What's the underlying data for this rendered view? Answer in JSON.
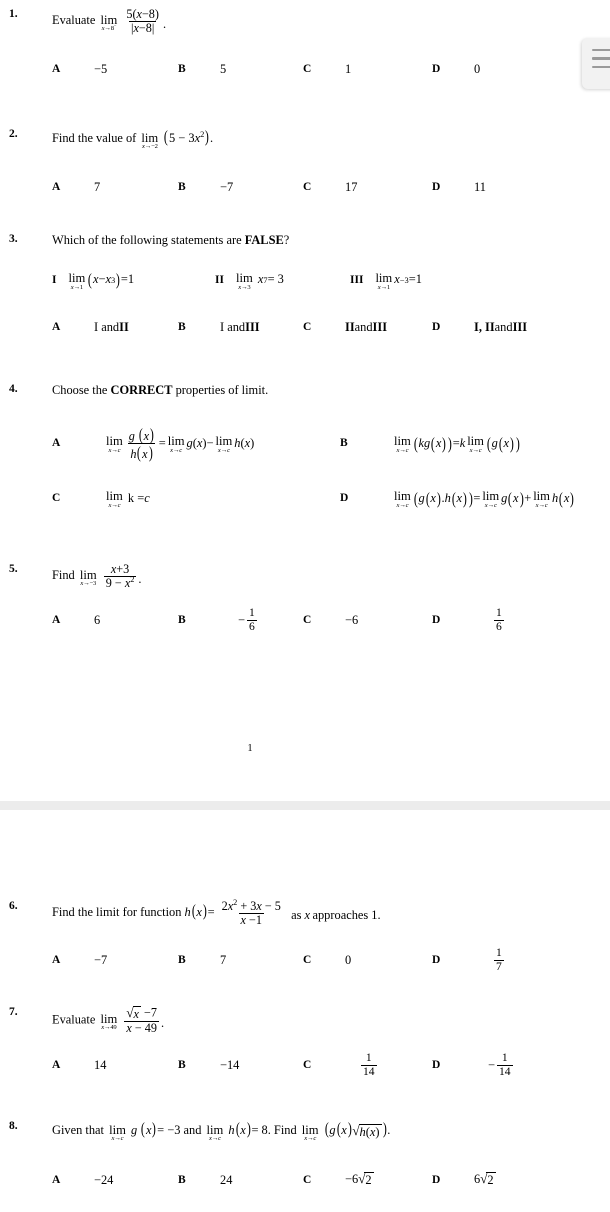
{
  "document": {
    "page_number": "1",
    "floating_widget": {
      "name": "menu-handle",
      "bars": 3
    }
  },
  "questions": [
    {
      "number": "1.",
      "prompt_prefix": "Evaluate",
      "expression": "lim(x→8⁻) 5(x−8)/|x−8|",
      "options": [
        {
          "letter": "A",
          "value": "−5"
        },
        {
          "letter": "B",
          "value": "5"
        },
        {
          "letter": "C",
          "value": "1"
        },
        {
          "letter": "D",
          "value": "0"
        }
      ]
    },
    {
      "number": "2.",
      "prompt_prefix": "Find the value of",
      "expression": "lim(x→−2) (5 − 3x²)",
      "options": [
        {
          "letter": "A",
          "value": "7"
        },
        {
          "letter": "B",
          "value": "−7"
        },
        {
          "letter": "C",
          "value": "17"
        },
        {
          "letter": "D",
          "value": "11"
        }
      ]
    },
    {
      "number": "3.",
      "prompt_prefix": "Which of the following statements are",
      "prompt_bold": "FALSE",
      "prompt_suffix": "?",
      "statements": [
        {
          "label": "I",
          "expression": "lim(x→1)(x − x³) = 1"
        },
        {
          "label": "II",
          "expression": "lim(x→3) x⁷ = 3"
        },
        {
          "label": "III",
          "expression": "lim(x→1) x⁻³ = 1"
        }
      ],
      "options": [
        {
          "letter": "A",
          "value": "I and II"
        },
        {
          "letter": "B",
          "value": "I and III"
        },
        {
          "letter": "C",
          "value": "II and III"
        },
        {
          "letter": "D",
          "value": "I, II and III"
        }
      ]
    },
    {
      "number": "4.",
      "prompt_prefix": "Choose the",
      "prompt_bold": "CORRECT",
      "prompt_suffix": "properties of limit.",
      "options": [
        {
          "letter": "A",
          "value": "lim(x→c) g(x)/h(x) = lim(x→c) g(x) − lim(x→c) h(x)"
        },
        {
          "letter": "B",
          "value": "lim(x→c)(kg(x)) = k lim(x→c)(g(x))"
        },
        {
          "letter": "C",
          "value": "lim(x→c) k = c"
        },
        {
          "letter": "D",
          "value": "lim(x→c)(g(x).h(x)) = lim(x→c) g(x) + lim(x→c) h(x)"
        }
      ]
    },
    {
      "number": "5.",
      "prompt_prefix": "Find",
      "expression": "lim(x→−3) (x+3)/(9 − x²)",
      "options": [
        {
          "letter": "A",
          "value": "6"
        },
        {
          "letter": "B",
          "value": "−1/6"
        },
        {
          "letter": "C",
          "value": "−6"
        },
        {
          "letter": "D",
          "value": "1/6"
        }
      ]
    },
    {
      "number": "6.",
      "prompt_prefix": "Find the limit for function",
      "expression": "h(x) = (2x² + 3x − 5)/(x − 1)",
      "prompt_suffix": "as x approaches 1.",
      "options": [
        {
          "letter": "A",
          "value": "−7"
        },
        {
          "letter": "B",
          "value": "7"
        },
        {
          "letter": "C",
          "value": "0"
        },
        {
          "letter": "D",
          "value": "1/7"
        }
      ]
    },
    {
      "number": "7.",
      "prompt_prefix": "Evaluate",
      "expression": "lim(x→49) (√x − 7)/(x − 49)",
      "options": [
        {
          "letter": "A",
          "value": "14"
        },
        {
          "letter": "B",
          "value": "−14"
        },
        {
          "letter": "C",
          "value": "1/14"
        },
        {
          "letter": "D",
          "value": "−1/14"
        }
      ]
    },
    {
      "number": "8.",
      "prompt_prefix": "Given that",
      "expression": "lim(x→c) g(x) = −3 and lim(x→c) h(x) = 8. Find lim(x→c)(g(x)√(h(x))).",
      "options": [
        {
          "letter": "A",
          "value": "−24"
        },
        {
          "letter": "B",
          "value": "24"
        },
        {
          "letter": "C",
          "value": "−6√2"
        },
        {
          "letter": "D",
          "value": "6√2"
        }
      ]
    }
  ],
  "labels": {
    "q1_number": "1.",
    "q2_number": "2.",
    "q3_number": "3.",
    "q4_number": "4.",
    "q5_number": "5.",
    "q6_number": "6.",
    "q7_number": "7.",
    "q8_number": "8."
  }
}
